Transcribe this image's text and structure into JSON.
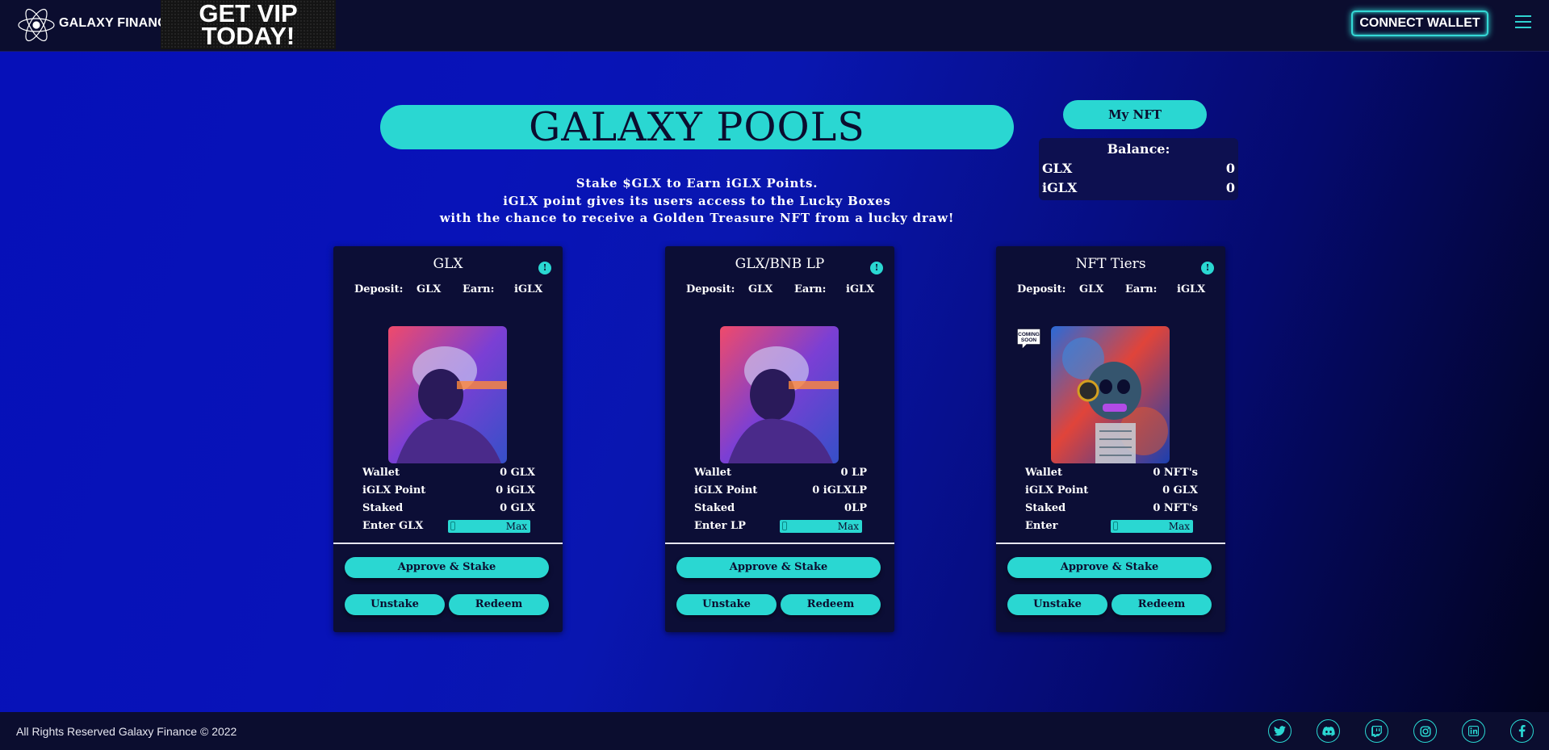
{
  "header": {
    "brand": "GALAXY FINANCE",
    "vip_banner": [
      "GET VIP",
      "TODAY!"
    ],
    "connect_label": "CONNECT WALLET",
    "icons": [
      "galaxy-logo-icon",
      "hamburger-menu-icon"
    ]
  },
  "hero": {
    "title": "GALAXY POOLS",
    "subtitle_lines": [
      "Stake $GLX to Earn iGLX Points.",
      "iGLX point gives its users access to the Lucky Boxes",
      "with the chance to receive a Golden Treasure NFT from a lucky draw!"
    ]
  },
  "wallet_panel": {
    "my_nft_label": "My NFT",
    "balance_label": "Balance:",
    "rows": [
      {
        "token": "GLX",
        "value": "0"
      },
      {
        "token": "iGLX",
        "value": "0"
      }
    ]
  },
  "pools": [
    {
      "title": "GLX",
      "deposit_label": "Deposit:",
      "deposit": "GLX",
      "earn_label": "Earn:",
      "earn": "iGLX",
      "coming_soon": false,
      "wallet_label": "Wallet",
      "wallet": "0 GLX",
      "point_label": "iGLX Point",
      "point": "0 iGLX",
      "staked_label": "Staked",
      "staked": "0 GLX",
      "enter_label": "Enter GLX",
      "enter_value": "",
      "max_label": "Max",
      "approve_label": "Approve & Stake",
      "unstake_label": "Unstake",
      "redeem_label": "Redeem"
    },
    {
      "title": "GLX/BNB LP",
      "deposit_label": "Deposit:",
      "deposit": "GLX",
      "earn_label": "Earn:",
      "earn": "iGLX",
      "coming_soon": false,
      "wallet_label": "Wallet",
      "wallet": "0 LP",
      "point_label": "iGLX Point",
      "point": "0 iGLXLP",
      "staked_label": "Staked",
      "staked": "0LP",
      "enter_label": "Enter LP",
      "enter_value": "",
      "max_label": "Max",
      "approve_label": "Approve & Stake",
      "unstake_label": "Unstake",
      "redeem_label": "Redeem"
    },
    {
      "title": "NFT Tiers",
      "deposit_label": "Deposit:",
      "deposit": "GLX",
      "earn_label": "Earn:",
      "earn": "iGLX",
      "coming_soon": true,
      "coming_soon_text": [
        "COMING",
        "SOON"
      ],
      "wallet_label": "Wallet",
      "wallet": "0 NFT's",
      "point_label": "iGLX Point",
      "point": "0 GLX",
      "staked_label": "Staked",
      "staked": "0 NFT's",
      "enter_label": "Enter",
      "enter_value": "",
      "max_label": "Max",
      "approve_label": "Approve & Stake",
      "unstake_label": "Unstake",
      "redeem_label": "Redeem"
    }
  ],
  "footer": {
    "copyright": "All Rights Reserved Galaxy Finance © 2022",
    "social_icons": [
      "twitter-icon",
      "discord-icon",
      "twitch-icon",
      "instagram-icon",
      "linkedin-icon",
      "facebook-icon"
    ]
  },
  "colors": {
    "accent": "#2ad7d2",
    "panel": "#0c0e36",
    "bar": "#0b0d2f"
  }
}
